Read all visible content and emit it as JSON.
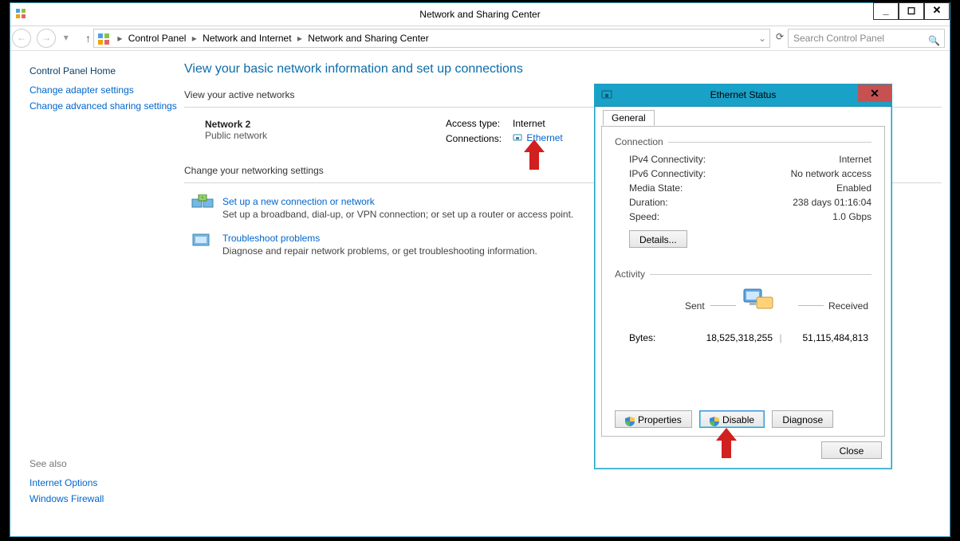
{
  "window": {
    "title": "Network and Sharing Center",
    "buttons": {
      "min": "_",
      "max": "◻",
      "close": "✕"
    }
  },
  "toolbar": {
    "breadcrumb": {
      "root": "Control Panel",
      "mid": "Network and Internet",
      "leaf": "Network and Sharing Center"
    },
    "search_placeholder": "Search Control Panel"
  },
  "side": {
    "home": "Control Panel Home",
    "links": {
      "adapter": "Change adapter settings",
      "advanced": "Change advanced sharing settings"
    },
    "seealso_title": "See also",
    "seealso": {
      "inet": "Internet Options",
      "fw": "Windows Firewall"
    }
  },
  "main": {
    "heading": "View your basic network information and set up connections",
    "active_title": "View your active networks",
    "network": {
      "name": "Network  2",
      "type": "Public network",
      "access_label": "Access type:",
      "access_value": "Internet",
      "conn_label": "Connections:",
      "conn_link": "Ethernet"
    },
    "change_title": "Change your networking settings",
    "task1": {
      "link": "Set up a new connection or network",
      "desc": "Set up a broadband, dial-up, or VPN connection; or set up a router or access point."
    },
    "task2": {
      "link": "Troubleshoot problems",
      "desc": "Diagnose and repair network problems, or get troubleshooting information."
    }
  },
  "dialog": {
    "title": "Ethernet Status",
    "tab": "General",
    "conn_title": "Connection",
    "conn": {
      "ipv4_label": "IPv4 Connectivity:",
      "ipv4_val": "Internet",
      "ipv6_label": "IPv6 Connectivity:",
      "ipv6_val": "No network access",
      "media_label": "Media State:",
      "media_val": "Enabled",
      "dur_label": "Duration:",
      "dur_val": "238 days 01:16:04",
      "speed_label": "Speed:",
      "speed_val": "1.0 Gbps"
    },
    "details_btn": "Details...",
    "activity_title": "Activity",
    "activity": {
      "sent_label": "Sent",
      "recv_label": "Received",
      "bytes_label": "Bytes:",
      "sent": "18,525,318,255",
      "recv": "51,115,484,813"
    },
    "buttons": {
      "props": "Properties",
      "disable": "Disable",
      "diag": "Diagnose",
      "close": "Close"
    }
  }
}
